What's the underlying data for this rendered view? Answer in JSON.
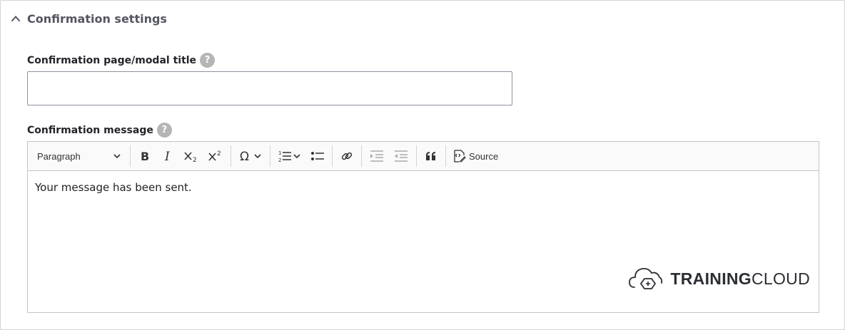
{
  "section": {
    "title": "Confirmation settings",
    "expanded": true
  },
  "fields": {
    "title_label": "Confirmation page/modal title",
    "title_value": "",
    "message_label": "Confirmation message",
    "help_glyph": "?"
  },
  "editor": {
    "paragraph_label": "Paragraph",
    "source_label": "Source",
    "content": "Your message has been sent.",
    "tools": [
      "bold-icon",
      "italic-icon",
      "subscript-icon",
      "superscript-icon",
      "special-characters-icon",
      "numbered-list-icon",
      "bulleted-list-icon",
      "link-icon",
      "outdent-icon",
      "indent-icon",
      "blockquote-icon",
      "source-icon"
    ]
  },
  "brand": {
    "part1": "TRAINING",
    "part2": "CLOUD"
  },
  "colors": {
    "help_bg": "#b5b5b5",
    "border": "#c4c4c4",
    "text": "#222330"
  }
}
